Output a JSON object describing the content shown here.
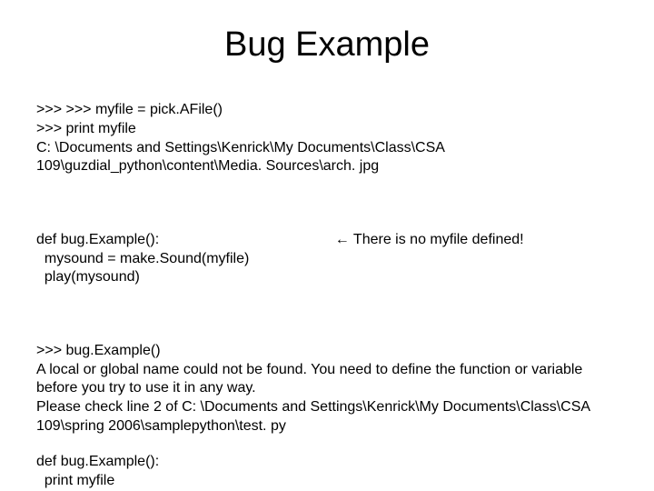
{
  "title": "Bug Example",
  "block1": ">>> >>> myfile = pick.AFile()\n>>> print myfile\nC: \\Documents and Settings\\Kenrick\\My Documents\\Class\\CSA 109\\guzdial_python\\content\\Media. Sources\\arch. jpg",
  "block2_code": "def bug.Example():\n  mysound = make.Sound(myfile)\n  play(mysound)",
  "block2_note": " ← There is no myfile defined!",
  "block3": ">>> bug.Example()\nA local or global name could not be found. You need to define the function or variable before you try to use it in any way.\nPlease check line 2 of C: \\Documents and Settings\\Kenrick\\My Documents\\Class\\CSA 109\\spring 2006\\samplepython\\test. py",
  "block4": "def bug.Example():\n  print myfile"
}
